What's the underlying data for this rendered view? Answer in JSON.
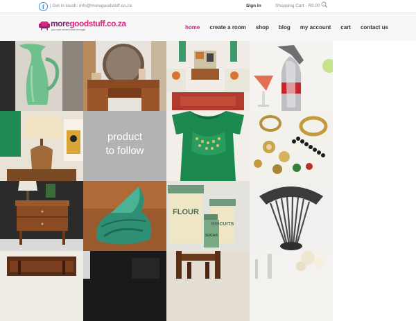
{
  "topbar": {
    "facebook_icon": "facebook-icon",
    "contact_text": "Get in touch: info@moregoodstuff.co.za",
    "sign_in": "Sign In",
    "cart_summary": "Shopping Cart - R0.00",
    "search_icon": "search-icon"
  },
  "brand": {
    "logo_part1": "more",
    "logo_part2": "goodstuff.co.za",
    "tagline": "you can never have enough",
    "logo_colors": [
      "#7a2b6f",
      "#e0267f"
    ]
  },
  "nav": {
    "items": [
      {
        "label": "home",
        "active": true
      },
      {
        "label": "create a room",
        "active": false
      },
      {
        "label": "shop",
        "active": false
      },
      {
        "label": "blog",
        "active": false
      },
      {
        "label": "my account",
        "active": false
      },
      {
        "label": "cart",
        "active": false
      },
      {
        "label": "contact us",
        "active": false
      }
    ],
    "accent_color": "#b3287a"
  },
  "grid": {
    "placeholder_line1": "product",
    "placeholder_line2": "to follow",
    "tiles": [
      {
        "subject": "green vase"
      },
      {
        "subject": "vanity dresser with mirror"
      },
      {
        "subject": "retro living room"
      },
      {
        "subject": "soda siphon and cocktail"
      },
      {
        "subject": "table lamp and art"
      },
      {
        "subject": "product placeholder"
      },
      {
        "subject": "green embroidered top"
      },
      {
        "subject": "costume jewellery"
      },
      {
        "subject": "lamp and side cabinet"
      },
      {
        "subject": "green shell vase"
      },
      {
        "subject": "flour biscuits sugar canisters"
      },
      {
        "subject": "fan back metal chair"
      },
      {
        "subject": "carved wooden furniture"
      },
      {
        "subject": "dark interior"
      },
      {
        "subject": "wooden chair back"
      },
      {
        "subject": "glassware and flowers"
      }
    ],
    "canister_labels": {
      "flour": "FLOUR",
      "biscuits": "BISCUITS",
      "sugar": "SUGAR"
    }
  }
}
